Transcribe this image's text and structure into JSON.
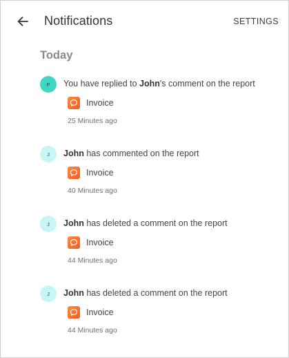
{
  "header": {
    "title": "Notifications",
    "settings_label": "SETTINGS"
  },
  "section": {
    "title": "Today"
  },
  "notifications": [
    {
      "avatar": "P",
      "avatar_color": "#3ed7c4",
      "before": "You have replied to ",
      "name": "John",
      "after": "'s comment on the report",
      "attachment": "Invoice",
      "time": "25 Minutes ago"
    },
    {
      "avatar": "J",
      "avatar_color": "#c8f6f6",
      "before": "",
      "name": "John",
      "after": " has commented on the report",
      "attachment": "Invoice",
      "time": "40 Minutes ago"
    },
    {
      "avatar": "J",
      "avatar_color": "#c8f6f6",
      "before": "",
      "name": "John",
      "after": " has deleted a comment on the report",
      "attachment": "Invoice",
      "time": "44 Minutes ago"
    },
    {
      "avatar": "J",
      "avatar_color": "#c8f6f6",
      "before": "",
      "name": "John",
      "after": " has deleted a comment on the report",
      "attachment": "Invoice",
      "time": "44 Minutes ago"
    }
  ],
  "icons": {
    "back": "arrow-left-icon",
    "attachment": "chat-bubble-icon"
  },
  "colors": {
    "attachment_icon": "#f26b2e",
    "section_title": "#8a8a8a"
  }
}
